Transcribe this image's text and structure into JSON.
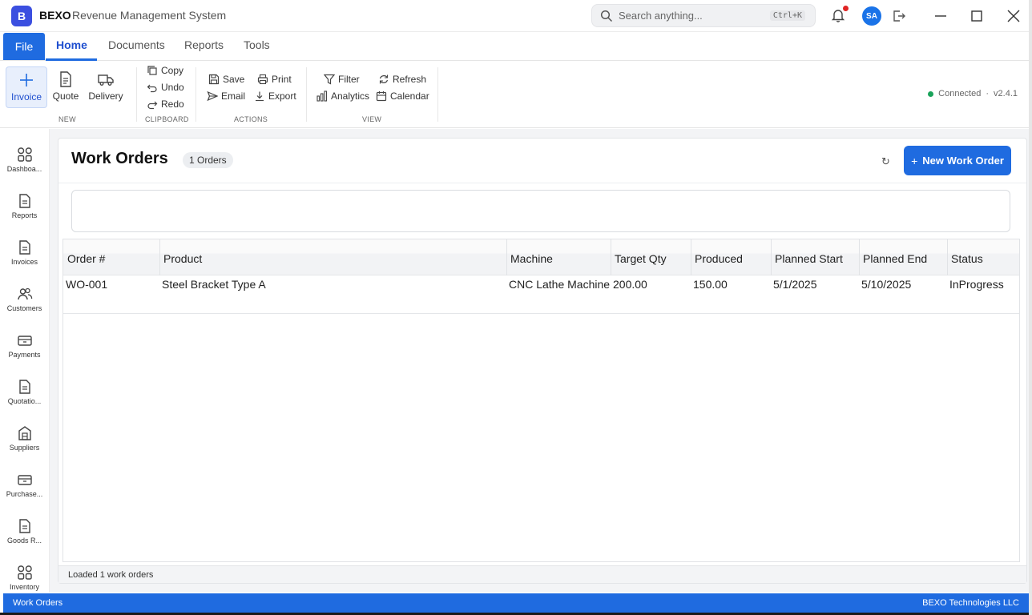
{
  "app": {
    "logo_letter": "B",
    "brand": "BEXO",
    "subtitle": "Revenue Management System"
  },
  "search": {
    "placeholder": "Search anything...",
    "shortcut": "Ctrl+K"
  },
  "user": {
    "initials": "SA"
  },
  "colors": {
    "accent": "#1f6be0",
    "connected": "#1aa35a",
    "notification_dot": "#e02424"
  },
  "tabs": {
    "file": "File",
    "items": [
      "Home",
      "Documents",
      "Reports",
      "Tools"
    ],
    "active": "Home"
  },
  "ribbon": {
    "new": {
      "label": "NEW",
      "invoice": "Invoice",
      "quote": "Quote",
      "delivery": "Delivery"
    },
    "clipboard": {
      "label": "CLIPBOARD",
      "copy": "Copy",
      "undo": "Undo",
      "redo": "Redo"
    },
    "actions": {
      "label": "ACTIONS",
      "save": "Save",
      "print": "Print",
      "email": "Email",
      "export": "Export"
    },
    "view": {
      "label": "VIEW",
      "filter": "Filter",
      "refresh": "Refresh",
      "analytics": "Analytics",
      "calendar": "Calendar"
    },
    "status": "Connected",
    "version": "v2.4.1"
  },
  "sidebar": {
    "items": [
      {
        "label": "Dashboa...",
        "icon": "dashboard-icon"
      },
      {
        "label": "Reports",
        "icon": "document-icon"
      },
      {
        "label": "Invoices",
        "icon": "document-icon"
      },
      {
        "label": "Customers",
        "icon": "users-icon"
      },
      {
        "label": "Payments",
        "icon": "card-icon"
      },
      {
        "label": "Quotatio...",
        "icon": "document-icon"
      },
      {
        "label": "Suppliers",
        "icon": "building-icon"
      },
      {
        "label": "Purchase...",
        "icon": "card-icon"
      },
      {
        "label": "Goods R...",
        "icon": "document-icon"
      },
      {
        "label": "Inventory",
        "icon": "dashboard-icon"
      }
    ]
  },
  "page": {
    "title": "Work Orders",
    "count_badge": "1 Orders",
    "refresh_glyph": "↻",
    "new_button": "New Work Order",
    "new_button_plus": "+"
  },
  "grid": {
    "columns": [
      "Order #",
      "Product",
      "Machine",
      "Target Qty",
      "Produced",
      "Planned Start",
      "Planned End",
      "Status"
    ],
    "rows": [
      [
        "WO-001",
        "Steel Bracket Type A",
        "CNC Lathe Machine",
        "200.00",
        "150.00",
        "5/1/2025",
        "5/10/2025",
        "InProgress"
      ]
    ]
  },
  "status_line": "Loaded 1 work orders",
  "footer": {
    "left": "Work Orders",
    "right": "BEXO Technologies LLC"
  }
}
